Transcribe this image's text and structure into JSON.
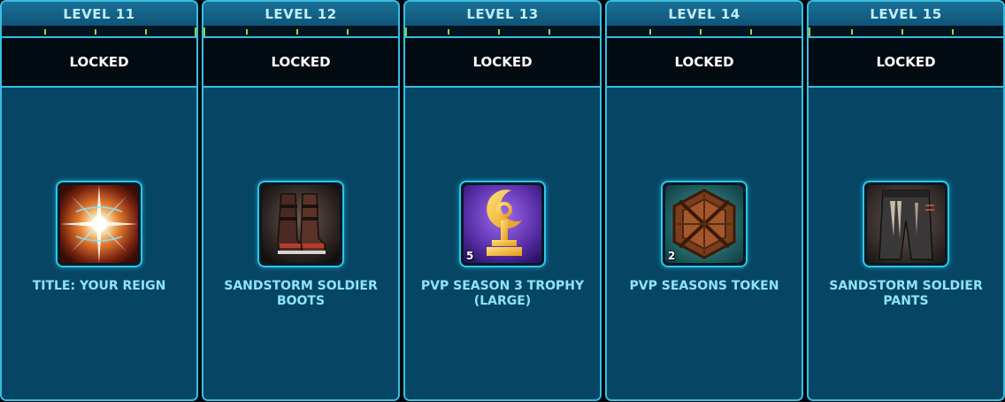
{
  "track": {
    "levels": [
      {
        "level_label": "LEVEL 11",
        "status": "LOCKED",
        "reward_name": "TITLE: YOUR REIGN",
        "quantity": "",
        "icon": "radiant-light-icon"
      },
      {
        "level_label": "LEVEL 12",
        "status": "LOCKED",
        "reward_name": "SANDSTORM SOLDIER BOOTS",
        "quantity": "",
        "icon": "boots-icon"
      },
      {
        "level_label": "LEVEL 13",
        "status": "LOCKED",
        "reward_name": "PVP SEASON 3 TROPHY (LARGE)",
        "quantity": "5",
        "icon": "trophy-icon"
      },
      {
        "level_label": "LEVEL 14",
        "status": "LOCKED",
        "reward_name": "PVP SEASONS TOKEN",
        "quantity": "2",
        "icon": "token-icon"
      },
      {
        "level_label": "LEVEL 15",
        "status": "LOCKED",
        "reward_name": "SANDSTORM SOLDIER PANTS",
        "quantity": "",
        "icon": "pants-icon"
      }
    ]
  },
  "colors": {
    "frame": "#35bfe0",
    "header_bg": "#1b6f96",
    "header_text": "#bfeefc",
    "reward_bg": "#064664",
    "reward_text": "#8fe4f7",
    "progress_tick": "#8fd85a"
  }
}
